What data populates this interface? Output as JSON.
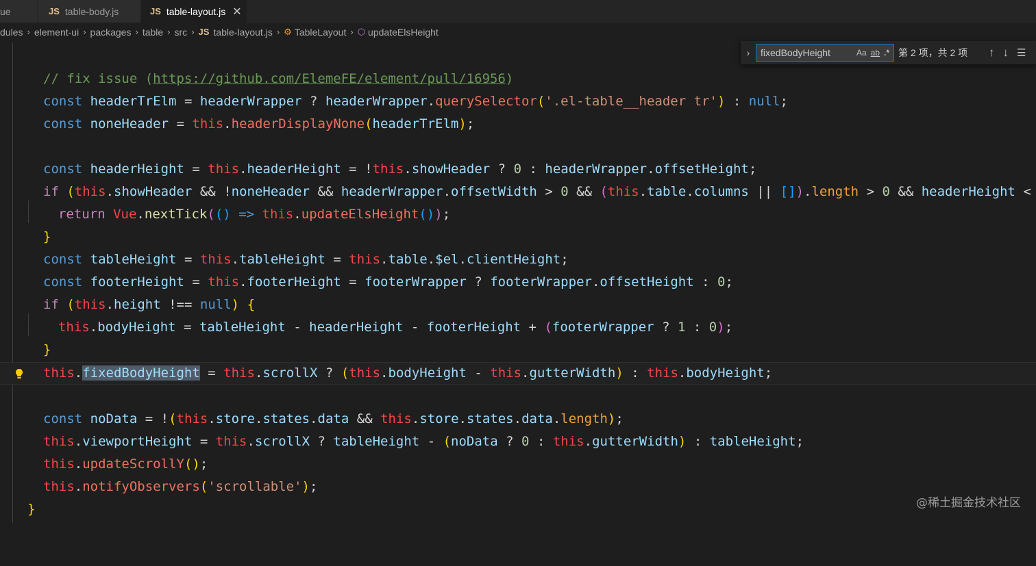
{
  "tabs": [
    {
      "label": "ue",
      "icon": "",
      "active": false
    },
    {
      "label": "table-body.js",
      "icon": "JS",
      "active": false
    },
    {
      "label": "table-layout.js",
      "icon": "JS",
      "active": true,
      "close": "✕"
    }
  ],
  "breadcrumb": {
    "items": [
      "dules",
      "element-ui",
      "packages",
      "table",
      "src",
      "table-layout.js",
      "TableLayout",
      "updateElsHeight"
    ],
    "file_icon": "JS"
  },
  "find": {
    "toggle": "›",
    "value": "fixedBodyHeight",
    "match_case": "Aa",
    "whole_word": "ab",
    "regex": ".*",
    "count": "第 2 项，共 2 项",
    "prev": "↑",
    "next": "↓",
    "menu": "☰"
  },
  "code": {
    "l1_comment": "// fix issue (",
    "l1_url": "https://github.com/ElemeFE/element/pull/16956",
    "l1_close": ")",
    "highlight_word": "fixedBodyHeight"
  },
  "watermark": "@稀土掘金技术社区",
  "colors": {
    "keyword": "#569cd6",
    "variable": "#9cdcfe",
    "this": "#f44747",
    "function": "#dcdcaa",
    "string": "#ce9178",
    "number": "#b5cea8"
  }
}
